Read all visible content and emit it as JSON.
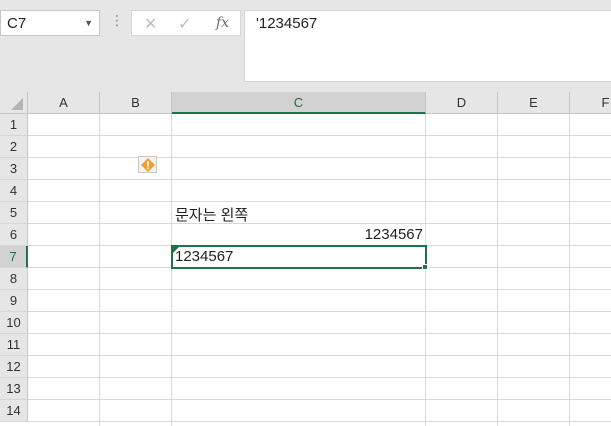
{
  "name_box": {
    "value": "C7"
  },
  "formula_bar": {
    "cancel_icon": "cancel-x-icon",
    "enter_icon": "enter-check-icon",
    "fx_label": "fx",
    "content": "'1234567"
  },
  "columns": [
    "A",
    "B",
    "C",
    "D",
    "E",
    "F"
  ],
  "selected_column": "C",
  "rows": [
    "1",
    "2",
    "3",
    "4",
    "5",
    "6",
    "7",
    "8",
    "9",
    "10",
    "11",
    "12",
    "13",
    "14"
  ],
  "selected_row": "7",
  "cells": {
    "C5": "문자는 왼쪽",
    "C6": "1234567",
    "C7": "1234567"
  },
  "error_indicator": {
    "icon": "warning-diamond-icon",
    "color": "#217346"
  },
  "colors": {
    "accent": "#217346",
    "warning": "#f0a22c"
  }
}
